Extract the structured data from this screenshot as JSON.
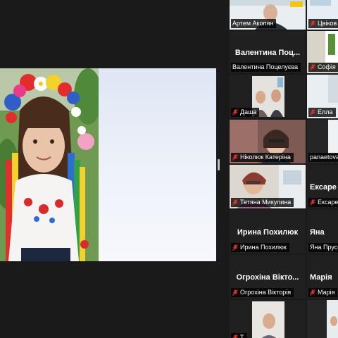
{
  "colors": {
    "active_speaker_outline": "#c8d600",
    "muted_icon": "#e0342e",
    "panel_background": "#1a1a1a"
  },
  "gallery": {
    "tiles": [
      {
        "name": "Артем Акопян",
        "caption": "Артем Акопян",
        "video": true,
        "active": true,
        "muted": false
      },
      {
        "name": "Цвіков",
        "caption": "Цвіков",
        "video": true,
        "active": false,
        "muted": false
      },
      {
        "name": "Валентина Поц...",
        "caption": "Валентина Поцелуєва",
        "video": false,
        "muted": true
      },
      {
        "name": "Софія",
        "caption": "Софія",
        "video": true,
        "muted": true
      },
      {
        "name": "Даша",
        "caption": "Даша",
        "video": true,
        "muted": true
      },
      {
        "name": "Елла",
        "caption": "Елла",
        "video": true,
        "muted": true
      },
      {
        "name": "Ніколюк Катеріна",
        "caption": "Ніколюк Катеріна",
        "video": true,
        "muted": true
      },
      {
        "name": "panaetova",
        "caption": "panaetova",
        "video": true,
        "muted": false
      },
      {
        "name": "Тетяна Микулина",
        "caption": "Тетяна Микулина",
        "video": true,
        "muted": true
      },
      {
        "name": "Ексаре",
        "caption": "Ексаре",
        "video": false,
        "muted": true
      },
      {
        "name": "Ирина Похилюк",
        "caption": "Ирина Похилюк",
        "video": false,
        "muted": true
      },
      {
        "name": "Яна",
        "caption": "Яна Прусс",
        "video": false,
        "muted": false
      },
      {
        "name": "Огрохіна Вікто...",
        "caption": "Огрохіна Вікторія",
        "video": false,
        "muted": true
      },
      {
        "name": "Марія",
        "caption": "Марія",
        "video": false,
        "muted": true
      },
      {
        "name": "Т",
        "caption": "Т",
        "video": true,
        "muted": true
      },
      {
        "name": "",
        "caption": "",
        "video": true,
        "muted": false
      }
    ]
  }
}
